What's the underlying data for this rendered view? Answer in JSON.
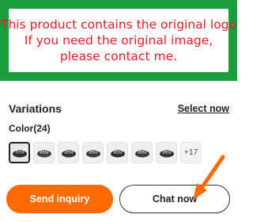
{
  "banner": {
    "line1": "This product contains the original logo",
    "line2": "If you need the original image,",
    "line3": "please contact me.",
    "frame_color": "#1a9e3c",
    "text_color": "#e0202a"
  },
  "variations": {
    "title": "Variations",
    "select_now_label": "Select now"
  },
  "color": {
    "label": "Color(24)",
    "visible_swatch_count": 7,
    "selected_index": 0,
    "more_label": "+17"
  },
  "actions": {
    "send_inquiry_label": "Send inquiry",
    "chat_now_label": "Chat now",
    "primary_color": "#ff6a00",
    "arrow_color": "#ff6a00"
  }
}
